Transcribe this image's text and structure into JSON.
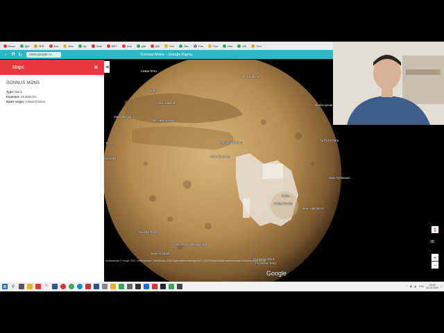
{
  "browser": {
    "tabs": [
      {
        "label": "Марс",
        "color": "#e8383d"
      },
      {
        "label": "ДМ",
        "color": "#3ba55d"
      },
      {
        "label": "ЗЕЕ",
        "color": "#d9a32b"
      },
      {
        "label": "Без",
        "color": "#e8383d"
      },
      {
        "label": "Мос",
        "color": "#e8b12b"
      },
      {
        "label": "Ар",
        "color": "#3ba55d"
      },
      {
        "label": "Коф",
        "color": "#c33"
      },
      {
        "label": "МЕГ",
        "color": "#d33"
      },
      {
        "label": "Апр",
        "color": "#e8383d"
      },
      {
        "label": "ДМ",
        "color": "#3ba55d"
      },
      {
        "label": "ДМ",
        "color": "#e8383d"
      },
      {
        "label": "Пол",
        "color": "#e8b12b"
      },
      {
        "label": "Ват",
        "color": "#3ba55d"
      },
      {
        "label": "Ров",
        "color": "#888"
      },
      {
        "label": "Gov",
        "color": "#e8b12b"
      },
      {
        "label": "Ипо",
        "color": "#3ba55d"
      },
      {
        "label": "МЕ",
        "color": "#3ba55d"
      },
      {
        "label": "Пол",
        "color": "#d9a32b"
      }
    ],
    "address": "www.google.ru",
    "page_title": "Gonnus Mons – Google Карты"
  },
  "panel": {
    "header": "Марс",
    "feature_name": "GONNUS MONS",
    "details": [
      {
        "key": "Type:",
        "value": " Mons"
      },
      {
        "key": "Diameter:",
        "value": " 49.3545 km"
      },
      {
        "key": "Name origin:",
        "value": " Classical Islam"
      }
    ]
  },
  "map": {
    "labels": [
      {
        "text": "Arabia Terra"
      },
      {
        "text": "Terra Sabaea"
      },
      {
        "text": "Eden"
      },
      {
        "text": "Sinus Sabaeus"
      },
      {
        "text": "Sinus Meridiani"
      },
      {
        "text": "Deucalionis Regio"
      },
      {
        "text": "Moeris Lacus"
      },
      {
        "text": "Pandorae Fretum"
      },
      {
        "text": "Tyrrhena Terra"
      },
      {
        "text": "Mare Serpentis"
      },
      {
        "text": "Mare Tyrrhenum"
      },
      {
        "text": "Noachis"
      },
      {
        "text": "Hellas"
      },
      {
        "text": "Hellas Planitia"
      },
      {
        "text": "Mare Hadriacum"
      },
      {
        "text": "Noachis Terra"
      },
      {
        "text": "Depressio Hellespontica"
      },
      {
        "text": "Mare Australe"
      },
      {
        "text": "Promethei Sinus"
      },
      {
        "text": "Promethei Terra"
      },
      {
        "text": "Terra"
      }
    ],
    "brand": "Google",
    "attribution": "Изображения © Google, 2020, Изображения © TerraMetrics, 2020, Картографические данные © 2020   Россия   Условия использования   Оставить отзыв   500 км",
    "view_label": "3D",
    "zoom_in": "+",
    "zoom_out": "−"
  },
  "taskbar": {
    "time": "15:00",
    "date": "02.09.2020",
    "lang": "РУС"
  }
}
